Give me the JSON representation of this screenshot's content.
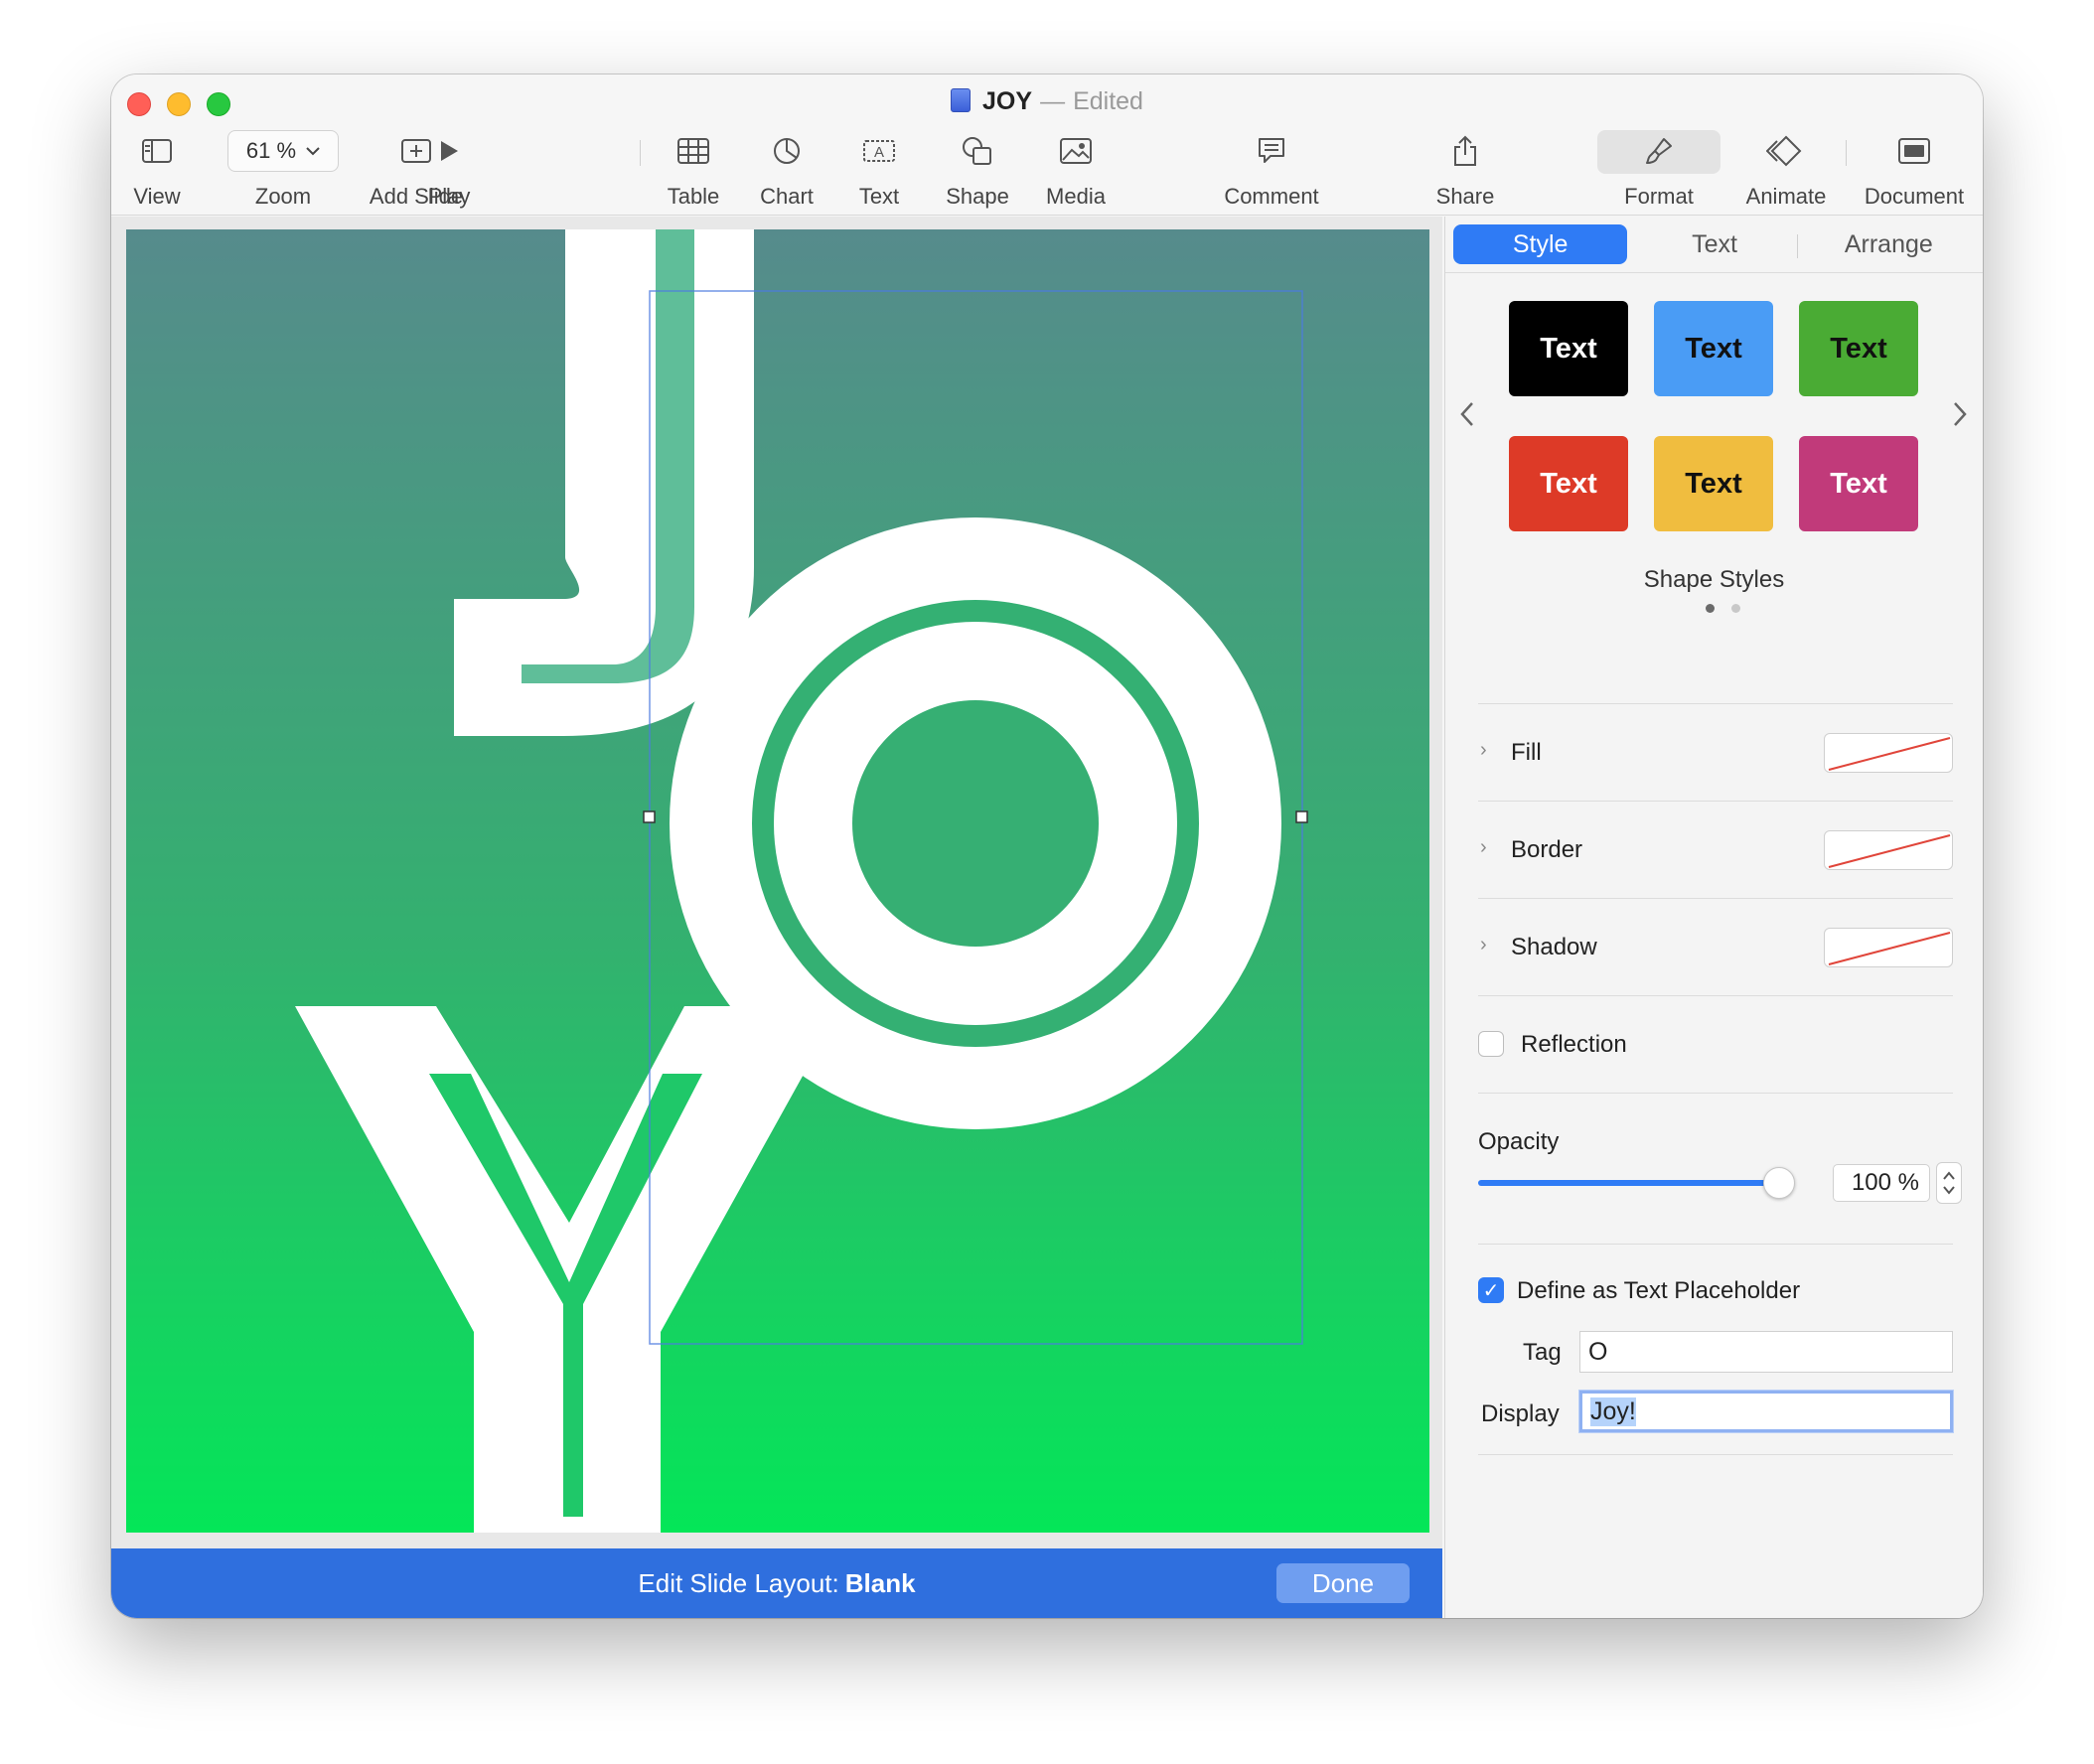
{
  "window": {
    "title": "JOY",
    "title_separator": "—",
    "status": "Edited"
  },
  "toolbar": {
    "view": "View",
    "zoom_value": "61 %",
    "zoom": "Zoom",
    "add_slide": "Add Slide",
    "play": "Play",
    "table": "Table",
    "chart": "Chart",
    "text": "Text",
    "shape": "Shape",
    "media": "Media",
    "comment": "Comment",
    "share": "Share",
    "format": "Format",
    "animate": "Animate",
    "document": "Document"
  },
  "edit_bar": {
    "label": "Edit Slide Layout:",
    "layout": "Blank",
    "done": "Done"
  },
  "inspector": {
    "tabs": [
      "Style",
      "Text",
      "Arrange"
    ],
    "shape_styles": {
      "title": "Shape Styles",
      "swatches": [
        {
          "label": "Text",
          "bg": "#000000",
          "fg": "#ffffff"
        },
        {
          "label": "Text",
          "bg": "#4a9cf5",
          "fg": "#111111"
        },
        {
          "label": "Text",
          "bg": "#4aab34",
          "fg": "#111111"
        },
        {
          "label": "Text",
          "bg": "#dd3a27",
          "fg": "#ffffff"
        },
        {
          "label": "Text",
          "bg": "#f0bd3f",
          "fg": "#111111"
        },
        {
          "label": "Text",
          "bg": "#c13a7a",
          "fg": "#ffffff"
        }
      ],
      "page_count": 2,
      "current_page": 1
    },
    "fill": "Fill",
    "border": "Border",
    "shadow": "Shadow",
    "reflection": "Reflection",
    "reflection_checked": false,
    "opacity_label": "Opacity",
    "opacity_value": "100 %",
    "opacity_fraction": 1.0,
    "placeholder_label": "Define as Text Placeholder",
    "placeholder_checked": true,
    "tag_label": "Tag",
    "tag_value": "O",
    "display_label": "Display",
    "display_value": "Joy!"
  },
  "colors": {
    "accent": "#2f7bf5",
    "edit_bar": "#2f6fde",
    "slide_gradient_top": "#568b8c",
    "slide_gradient_bottom": "#04e658"
  }
}
